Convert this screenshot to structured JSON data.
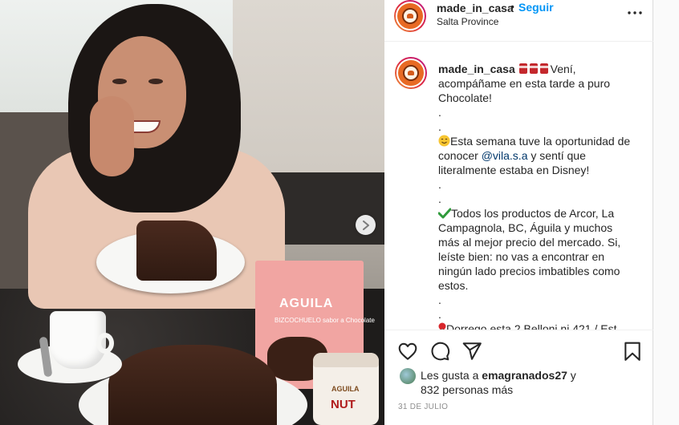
{
  "post": {
    "header": {
      "username": "made_in_casa",
      "dot": "•",
      "follow_label": "Seguir",
      "location": "Salta Province"
    },
    "caption": {
      "username": "made_in_casa",
      "line1": "Vení, acompáñame en esta tarde a puro Chocolate!",
      "dot1": ".",
      "dot2": ".",
      "line2_pre": "Esta semana tuve la oportunidad de conocer ",
      "mention": "@vila.s.a",
      "line2_post": " y sentí que literalmente estaba en Disney!",
      "dot3": ".",
      "dot4": ".",
      "line3": "Todos los productos de Arcor, La Campagnola, BC, Águila y muchos más al mejor precio del mercado. Si, leíste bien: no vas a encontrar en ningún lado precios imbatibles como estos.",
      "dot5": ".",
      "dot6": ".",
      "line4_partial": "Dorrego esta 2 Belloni ni 421 / Est"
    },
    "likes": {
      "prefix": "Les gusta a ",
      "user": "emagranados27",
      "middle": " y ",
      "count": "832 personas más"
    },
    "date": "31 DE JULIO"
  },
  "photo": {
    "box_brand": "AGUILA",
    "box_subtitle": "BIZCOCHUELO sabor a Chocolate",
    "jar_brand": "AGUILA",
    "jar_label": "NUT"
  },
  "icons": {
    "more": "more-dots-icon",
    "next": "chevron-right-icon",
    "like": "heart-icon",
    "comment": "comment-icon",
    "share": "send-icon",
    "save": "bookmark-icon"
  },
  "colors": {
    "follow": "#0095f6",
    "mention": "#00376b",
    "secondary_text": "#8e8e8e"
  }
}
